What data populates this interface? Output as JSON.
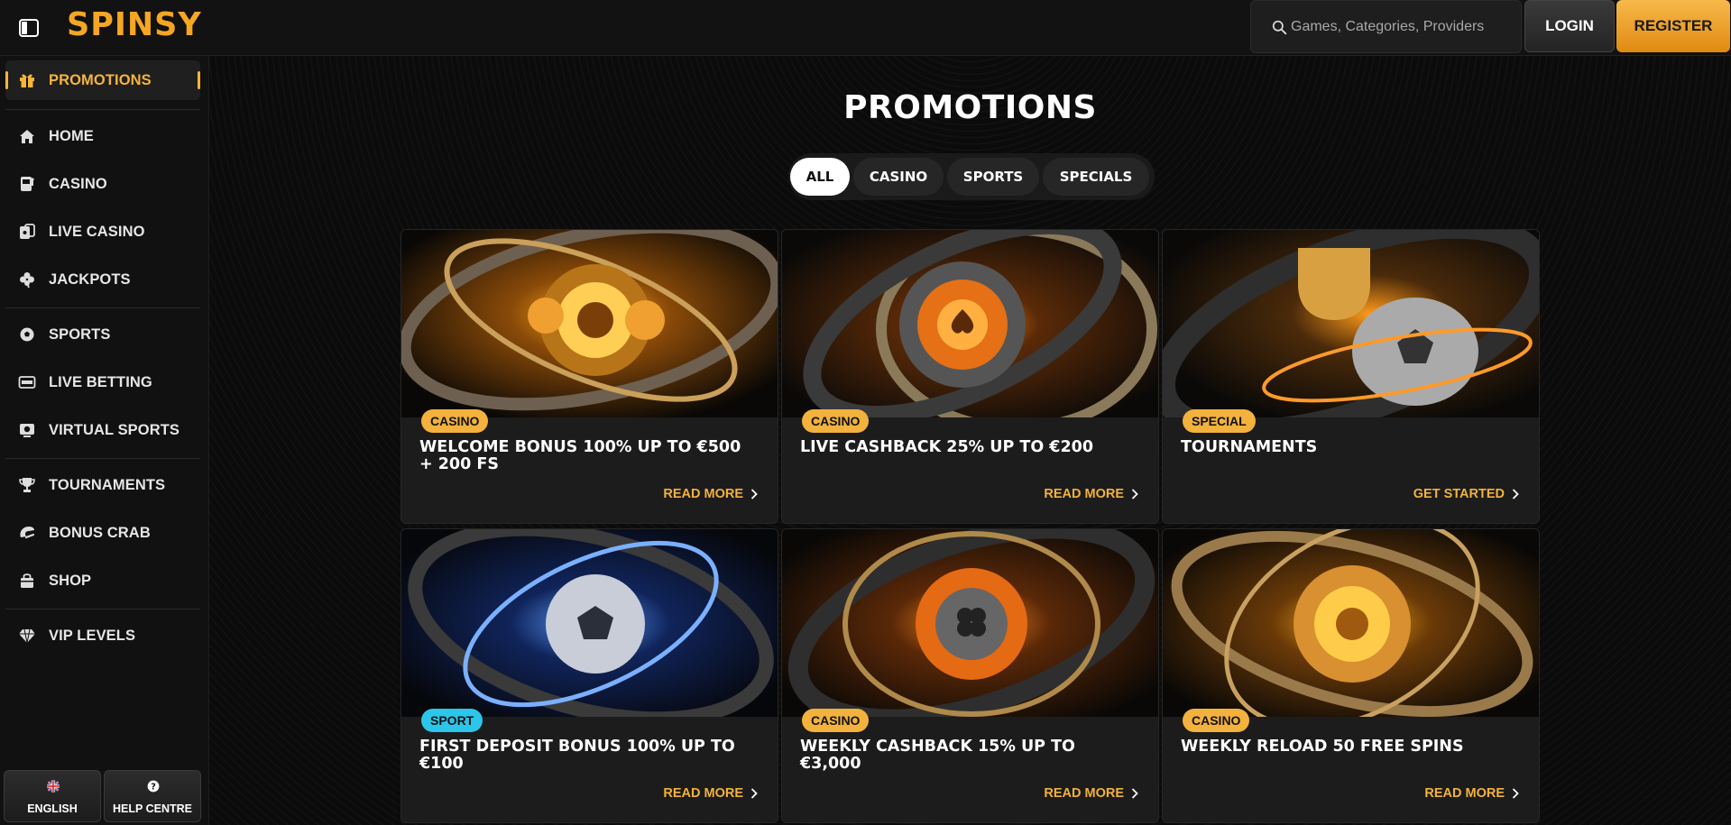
{
  "header": {
    "logo": "SPINSY",
    "search_placeholder": "Games, Categories, Providers",
    "login_label": "LOGIN",
    "register_label": "REGISTER"
  },
  "sidebar": {
    "items": [
      {
        "label": "PROMOTIONS",
        "icon": "gift-icon",
        "active": true
      },
      {
        "label": "HOME",
        "icon": "home-icon"
      },
      {
        "label": "CASINO",
        "icon": "slot-machine-icon"
      },
      {
        "label": "LIVE CASINO",
        "icon": "live-cards-icon"
      },
      {
        "label": "JACKPOTS",
        "icon": "clover-icon"
      },
      {
        "label": "SPORTS",
        "icon": "soccer-ball-icon"
      },
      {
        "label": "LIVE BETTING",
        "icon": "live-tv-icon"
      },
      {
        "label": "VIRTUAL SPORTS",
        "icon": "virtual-monitor-icon"
      },
      {
        "label": "TOURNAMENTS",
        "icon": "trophy-icon"
      },
      {
        "label": "BONUS CRAB",
        "icon": "crab-claw-icon"
      },
      {
        "label": "SHOP",
        "icon": "shopping-bag-icon"
      },
      {
        "label": "VIP LEVELS",
        "icon": "diamond-icon"
      }
    ],
    "footer": {
      "language_label": "ENGLISH",
      "help_label": "HELP CENTRE"
    }
  },
  "main": {
    "title": "PROMOTIONS",
    "filters": [
      {
        "label": "ALL",
        "active": true
      },
      {
        "label": "CASINO"
      },
      {
        "label": "SPORTS"
      },
      {
        "label": "SPECIALS"
      }
    ],
    "cards": [
      {
        "tag": "CASINO",
        "tag_type": "casino",
        "title": "WELCOME BONUS 100% UP TO €500 + 200 FS",
        "cta": "READ MORE",
        "theme": "gold"
      },
      {
        "tag": "CASINO",
        "tag_type": "casino",
        "title": "LIVE CASHBACK 25% UP TO €200",
        "cta": "READ MORE",
        "theme": "chip"
      },
      {
        "tag": "SPECIAL",
        "tag_type": "special",
        "title": "TOURNAMENTS",
        "cta": "GET STARTED",
        "theme": "trophy"
      },
      {
        "tag": "SPORT",
        "tag_type": "sport",
        "title": "FIRST DEPOSIT BONUS 100% UP TO €100",
        "cta": "READ MORE",
        "theme": "blue"
      },
      {
        "tag": "CASINO",
        "tag_type": "casino",
        "title": "WEEKLY CASHBACK 15% UP TO €3,000",
        "cta": "READ MORE",
        "theme": "clover"
      },
      {
        "tag": "CASINO",
        "tag_type": "casino",
        "title": "WEEKLY RELOAD 50 FREE SPINS",
        "cta": "READ MORE",
        "theme": "coin"
      }
    ]
  },
  "colors": {
    "accent": "#f2b23d",
    "sport_badge": "#2cc6ea",
    "background": "#0b0b0b"
  }
}
